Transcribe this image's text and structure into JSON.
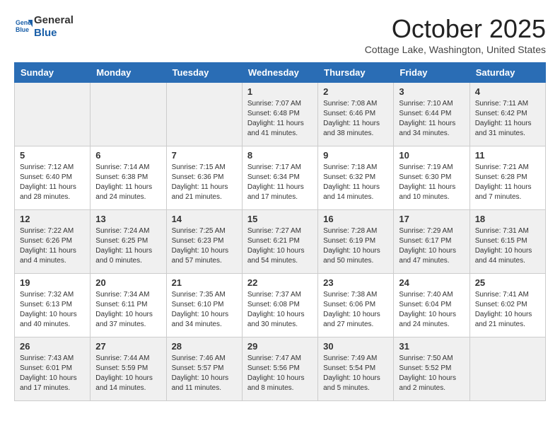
{
  "logo": {
    "line1": "General",
    "line2": "Blue"
  },
  "title": "October 2025",
  "location": "Cottage Lake, Washington, United States",
  "days_of_week": [
    "Sunday",
    "Monday",
    "Tuesday",
    "Wednesday",
    "Thursday",
    "Friday",
    "Saturday"
  ],
  "weeks": [
    [
      {
        "day": "",
        "text": ""
      },
      {
        "day": "",
        "text": ""
      },
      {
        "day": "",
        "text": ""
      },
      {
        "day": "1",
        "text": "Sunrise: 7:07 AM\nSunset: 6:48 PM\nDaylight: 11 hours and 41 minutes."
      },
      {
        "day": "2",
        "text": "Sunrise: 7:08 AM\nSunset: 6:46 PM\nDaylight: 11 hours and 38 minutes."
      },
      {
        "day": "3",
        "text": "Sunrise: 7:10 AM\nSunset: 6:44 PM\nDaylight: 11 hours and 34 minutes."
      },
      {
        "day": "4",
        "text": "Sunrise: 7:11 AM\nSunset: 6:42 PM\nDaylight: 11 hours and 31 minutes."
      }
    ],
    [
      {
        "day": "5",
        "text": "Sunrise: 7:12 AM\nSunset: 6:40 PM\nDaylight: 11 hours and 28 minutes."
      },
      {
        "day": "6",
        "text": "Sunrise: 7:14 AM\nSunset: 6:38 PM\nDaylight: 11 hours and 24 minutes."
      },
      {
        "day": "7",
        "text": "Sunrise: 7:15 AM\nSunset: 6:36 PM\nDaylight: 11 hours and 21 minutes."
      },
      {
        "day": "8",
        "text": "Sunrise: 7:17 AM\nSunset: 6:34 PM\nDaylight: 11 hours and 17 minutes."
      },
      {
        "day": "9",
        "text": "Sunrise: 7:18 AM\nSunset: 6:32 PM\nDaylight: 11 hours and 14 minutes."
      },
      {
        "day": "10",
        "text": "Sunrise: 7:19 AM\nSunset: 6:30 PM\nDaylight: 11 hours and 10 minutes."
      },
      {
        "day": "11",
        "text": "Sunrise: 7:21 AM\nSunset: 6:28 PM\nDaylight: 11 hours and 7 minutes."
      }
    ],
    [
      {
        "day": "12",
        "text": "Sunrise: 7:22 AM\nSunset: 6:26 PM\nDaylight: 11 hours and 4 minutes."
      },
      {
        "day": "13",
        "text": "Sunrise: 7:24 AM\nSunset: 6:25 PM\nDaylight: 11 hours and 0 minutes."
      },
      {
        "day": "14",
        "text": "Sunrise: 7:25 AM\nSunset: 6:23 PM\nDaylight: 10 hours and 57 minutes."
      },
      {
        "day": "15",
        "text": "Sunrise: 7:27 AM\nSunset: 6:21 PM\nDaylight: 10 hours and 54 minutes."
      },
      {
        "day": "16",
        "text": "Sunrise: 7:28 AM\nSunset: 6:19 PM\nDaylight: 10 hours and 50 minutes."
      },
      {
        "day": "17",
        "text": "Sunrise: 7:29 AM\nSunset: 6:17 PM\nDaylight: 10 hours and 47 minutes."
      },
      {
        "day": "18",
        "text": "Sunrise: 7:31 AM\nSunset: 6:15 PM\nDaylight: 10 hours and 44 minutes."
      }
    ],
    [
      {
        "day": "19",
        "text": "Sunrise: 7:32 AM\nSunset: 6:13 PM\nDaylight: 10 hours and 40 minutes."
      },
      {
        "day": "20",
        "text": "Sunrise: 7:34 AM\nSunset: 6:11 PM\nDaylight: 10 hours and 37 minutes."
      },
      {
        "day": "21",
        "text": "Sunrise: 7:35 AM\nSunset: 6:10 PM\nDaylight: 10 hours and 34 minutes."
      },
      {
        "day": "22",
        "text": "Sunrise: 7:37 AM\nSunset: 6:08 PM\nDaylight: 10 hours and 30 minutes."
      },
      {
        "day": "23",
        "text": "Sunrise: 7:38 AM\nSunset: 6:06 PM\nDaylight: 10 hours and 27 minutes."
      },
      {
        "day": "24",
        "text": "Sunrise: 7:40 AM\nSunset: 6:04 PM\nDaylight: 10 hours and 24 minutes."
      },
      {
        "day": "25",
        "text": "Sunrise: 7:41 AM\nSunset: 6:02 PM\nDaylight: 10 hours and 21 minutes."
      }
    ],
    [
      {
        "day": "26",
        "text": "Sunrise: 7:43 AM\nSunset: 6:01 PM\nDaylight: 10 hours and 17 minutes."
      },
      {
        "day": "27",
        "text": "Sunrise: 7:44 AM\nSunset: 5:59 PM\nDaylight: 10 hours and 14 minutes."
      },
      {
        "day": "28",
        "text": "Sunrise: 7:46 AM\nSunset: 5:57 PM\nDaylight: 10 hours and 11 minutes."
      },
      {
        "day": "29",
        "text": "Sunrise: 7:47 AM\nSunset: 5:56 PM\nDaylight: 10 hours and 8 minutes."
      },
      {
        "day": "30",
        "text": "Sunrise: 7:49 AM\nSunset: 5:54 PM\nDaylight: 10 hours and 5 minutes."
      },
      {
        "day": "31",
        "text": "Sunrise: 7:50 AM\nSunset: 5:52 PM\nDaylight: 10 hours and 2 minutes."
      },
      {
        "day": "",
        "text": ""
      }
    ]
  ]
}
